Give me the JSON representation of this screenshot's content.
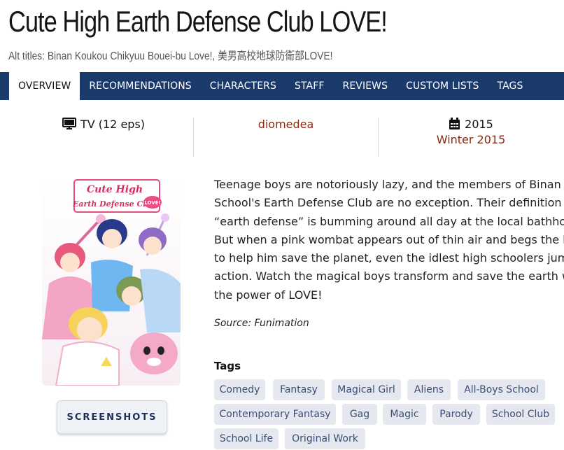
{
  "header": {
    "title": "Cute High Earth Defense Club LOVE!",
    "alt_titles": "Alt titles: Binan Koukou Chikyuu Bouei-bu Love!, 美男高校地球防衛部LOVE!"
  },
  "tabs": [
    {
      "label": "OVERVIEW",
      "active": true
    },
    {
      "label": "RECOMMENDATIONS",
      "active": false
    },
    {
      "label": "CHARACTERS",
      "active": false
    },
    {
      "label": "STAFF",
      "active": false
    },
    {
      "label": "REVIEWS",
      "active": false
    },
    {
      "label": "CUSTOM LISTS",
      "active": false
    },
    {
      "label": "TAGS",
      "active": false
    }
  ],
  "meta": {
    "format": "TV (12 eps)",
    "format_icon": "tv-icon",
    "studio": "diomedea",
    "year": "2015",
    "year_icon": "calendar-icon",
    "season": "Winter 2015"
  },
  "poster": {
    "logo_line1": "Cute High",
    "logo_line2": "Earth Defense Club",
    "logo_badge": "LOVE!"
  },
  "screenshots_button": "SCREENSHOTS",
  "synopsis": "Teenage boys are notoriously lazy, and the members of Binan High School's Earth Defense Club are no exception. Their definition of “earth defense” is bumming around all day at the local bathhouse. But when a pink wombat appears out of thin air and begs the boys to help him save the planet, even the idlest high schoolers jump to action. Watch the magical boys transform and save the earth with the power of LOVE!",
  "source": "Source: Funimation",
  "tags_heading": "Tags",
  "tags": [
    "Comedy",
    "Fantasy",
    "Magical Girl",
    "Aliens",
    "All-Boys School",
    "Contemporary Fantasy",
    "Gag",
    "Magic",
    "Parody",
    "School Club",
    "School Life",
    "Original Work"
  ],
  "colors": {
    "nav_bar": "#1a3a6c",
    "accent_red": "#8a2a10",
    "tag_bg": "#e5e8ee",
    "tag_text": "#3d4d78"
  }
}
